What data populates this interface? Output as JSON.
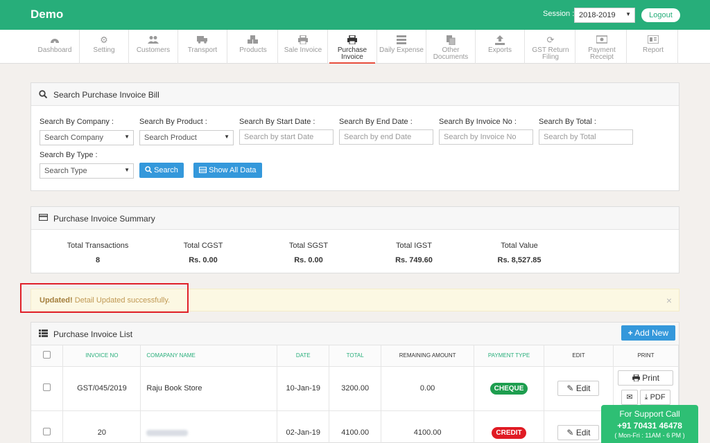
{
  "app": {
    "brand": "Demo"
  },
  "session": {
    "label": "Session :",
    "value": "2018-2019"
  },
  "header": {
    "logout_label": "Logout"
  },
  "nav": {
    "items": [
      {
        "label": "Dashboard",
        "icon": "dashboard-icon"
      },
      {
        "label": "Setting",
        "icon": "gear-icon"
      },
      {
        "label": "Customers",
        "icon": "users-icon"
      },
      {
        "label": "Transport",
        "icon": "truck-icon"
      },
      {
        "label": "Products",
        "icon": "cubes-icon"
      },
      {
        "label": "Sale Invoice",
        "icon": "printer-icon"
      },
      {
        "label": "Purchase Invoice",
        "icon": "printer-icon",
        "active": true
      },
      {
        "label": "Daily Expense",
        "icon": "list-icon"
      },
      {
        "label": "Other Documents",
        "icon": "documents-icon"
      },
      {
        "label": "Exports",
        "icon": "upload-icon"
      },
      {
        "label": "GST Return Filing",
        "icon": "refresh-icon"
      },
      {
        "label": "Payment Receipt",
        "icon": "money-icon"
      },
      {
        "label": "Report",
        "icon": "report-icon"
      }
    ]
  },
  "search": {
    "title": "Search Purchase Invoice Bill",
    "company_label": "Search By Company :",
    "company_value": "Search Company",
    "product_label": "Search By Product :",
    "product_value": "Search Product",
    "start_label": "Search By Start Date :",
    "start_placeholder": "Search by start Date",
    "end_label": "Search By End Date :",
    "end_placeholder": "Search by end Date",
    "invoice_label": "Search By Invoice No :",
    "invoice_placeholder": "Search by Invoice No",
    "total_label": "Search By Total :",
    "total_placeholder": "Search by Total",
    "type_label": "Search By Type :",
    "type_value": "Search Type",
    "search_button": "Search",
    "show_all_button": "Show All Data"
  },
  "summary": {
    "title": "Purchase Invoice Summary",
    "items": [
      {
        "label": "Total Transactions",
        "value": "8"
      },
      {
        "label": "Total CGST",
        "value": "Rs. 0.00"
      },
      {
        "label": "Total SGST",
        "value": "Rs. 0.00"
      },
      {
        "label": "Total IGST",
        "value": "Rs. 749.60"
      },
      {
        "label": "Total Value",
        "value": "Rs. 8,527.85"
      }
    ]
  },
  "alert": {
    "strong": "Updated!",
    "message": " Detail Updated successfully.",
    "close": "×"
  },
  "list": {
    "title": "Purchase Invoice List",
    "add_new": "Add New",
    "columns": [
      "INVOICE NO",
      "COMAPANY NAME",
      "DATE",
      "TOTAL",
      "REMAINING AMOUNT",
      "PAYMENT TYPE",
      "EDIT",
      "PRINT"
    ],
    "edit_label": "Edit",
    "print_label": "Print",
    "pdf_label": "PDF",
    "rows": [
      {
        "invoice_no": "GST/045/2019",
        "company": "Raju Book Store",
        "date": "10-Jan-19",
        "total": "3200.00",
        "remaining": "0.00",
        "payment_type": "CHEQUE",
        "payment_color": "#1e9e4f"
      },
      {
        "invoice_no": "20",
        "company": "",
        "date": "02-Jan-19",
        "total": "4100.00",
        "remaining": "4100.00",
        "payment_type": "CREDIT",
        "payment_color": "#e01b24"
      }
    ]
  },
  "support": {
    "line1": "For Support Call",
    "phone": "+91 70431 46478",
    "hours": "( Mon-Fri : 11AM - 6 PM )"
  }
}
